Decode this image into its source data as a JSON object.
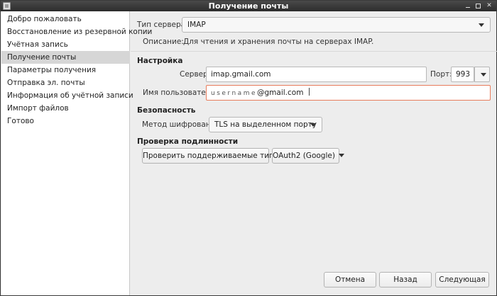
{
  "window": {
    "title": "Получение почты"
  },
  "sidebar": {
    "items": [
      {
        "label": "Добро пожаловать"
      },
      {
        "label": "Восстановление из резервной копии"
      },
      {
        "label": "Учётная запись"
      },
      {
        "label": "Получение почты",
        "active": true
      },
      {
        "label": "Параметры получения"
      },
      {
        "label": "Отправка эл. почты"
      },
      {
        "label": "Информация об учётной записи"
      },
      {
        "label": "Импорт файлов"
      },
      {
        "label": "Готово"
      }
    ]
  },
  "server_type": {
    "label": "Тип сервера:",
    "value": "IMAP"
  },
  "description": {
    "label": "Описание:",
    "value": "Для чтения и хранения почты на серверах IMAP."
  },
  "settings": {
    "heading": "Настройка",
    "server_label": "Сервер:",
    "server_value": "imap.gmail.com",
    "port_label": "Порт:",
    "port_value": "993",
    "username_label": "Имя пользователя:",
    "username_placeholder": "username",
    "username_suffix": "@gmail.com"
  },
  "security": {
    "heading": "Безопасность",
    "encryption_label": "Метод шифрования:",
    "encryption_value": "TLS на выделенном порту"
  },
  "auth": {
    "heading": "Проверка подлинности",
    "check_button": "Проверить поддерживаемые типы",
    "method_value": "OAuth2 (Google)"
  },
  "footer": {
    "cancel": "Отмена",
    "back": "Назад",
    "next": "Следующая"
  },
  "colors": {
    "error_border": "#e87c5c",
    "active_item": "#d6d6d6"
  }
}
